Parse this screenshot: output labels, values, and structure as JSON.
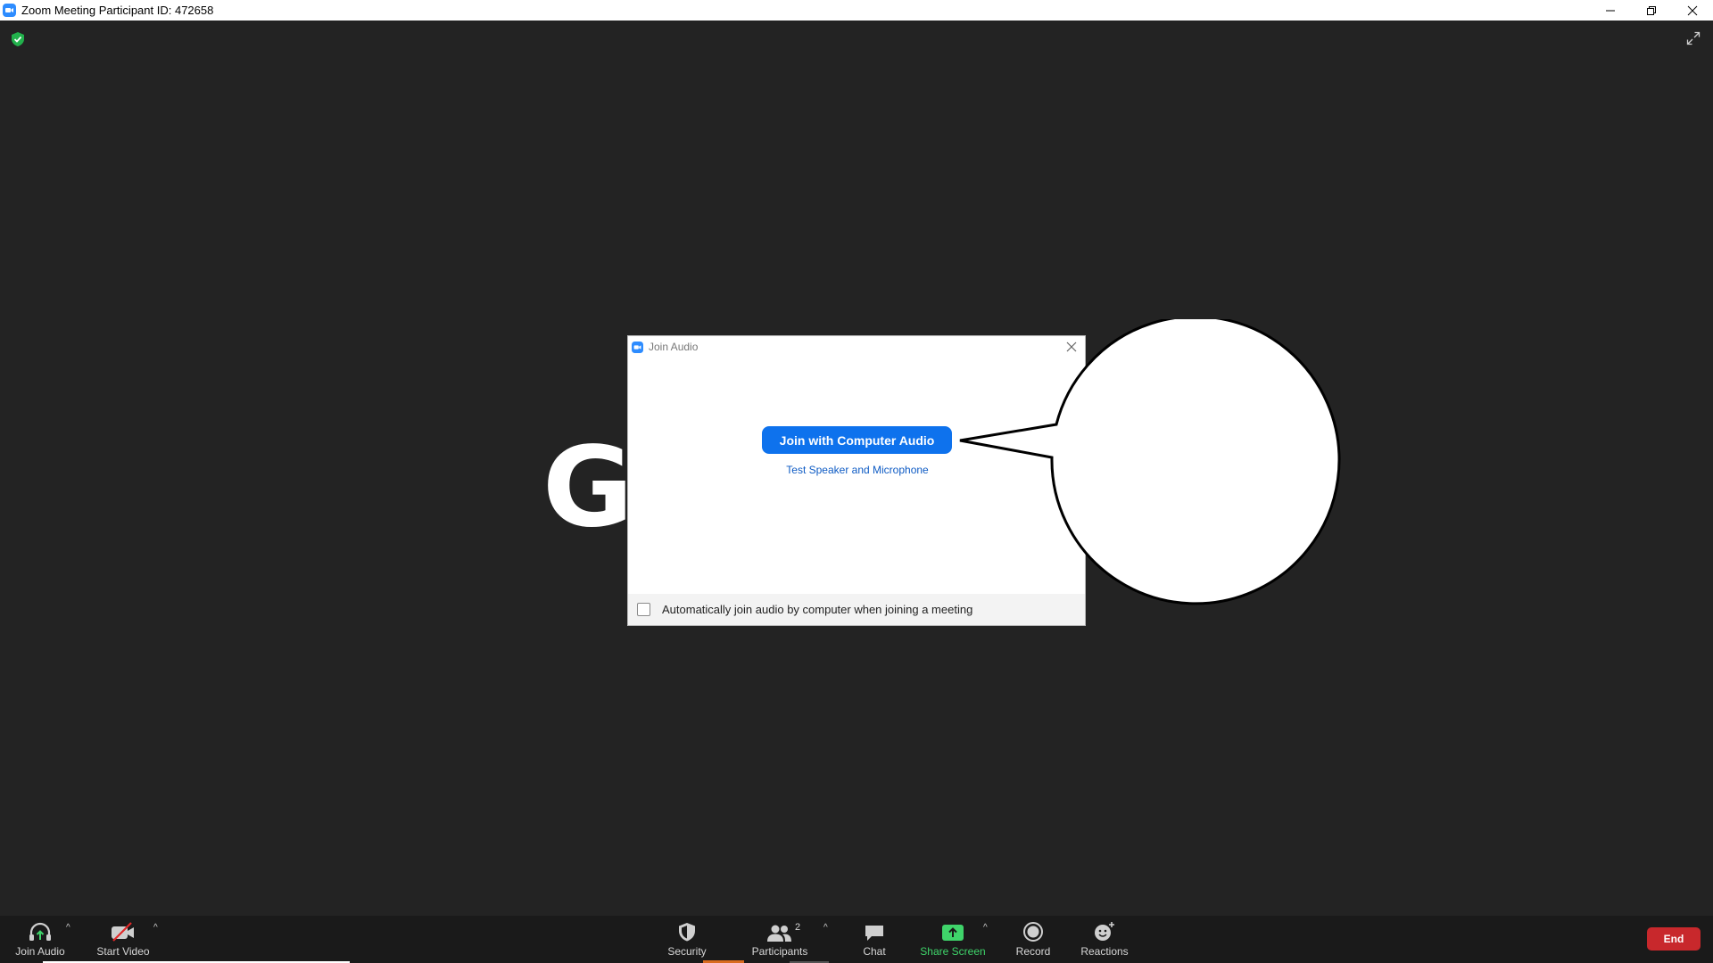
{
  "window": {
    "title": "Zoom Meeting Participant ID: 472658",
    "controls": [
      "minimize-icon",
      "restore-icon",
      "close-icon"
    ]
  },
  "meeting": {
    "avatar_letter": "G",
    "icons": [
      "shield-check-icon",
      "fullscreen-icon"
    ]
  },
  "dialog": {
    "title": "Join Audio",
    "join_button": "Join with Computer Audio",
    "test_link": "Test Speaker and Microphone",
    "auto_join_label": "Automatically join audio by computer when joining a meeting",
    "auto_join_checked": false
  },
  "toolbar": {
    "join_audio": "Join Audio",
    "start_video": "Start Video",
    "security": "Security",
    "participants": "Participants",
    "participants_count": "2",
    "chat": "Chat",
    "share_screen": "Share Screen",
    "record": "Record",
    "reactions": "Reactions",
    "end": "End"
  },
  "colors": {
    "accent_blue": "#0e72ed",
    "share_green": "#3fd46a",
    "end_red": "#c8282c",
    "background": "#232323"
  }
}
